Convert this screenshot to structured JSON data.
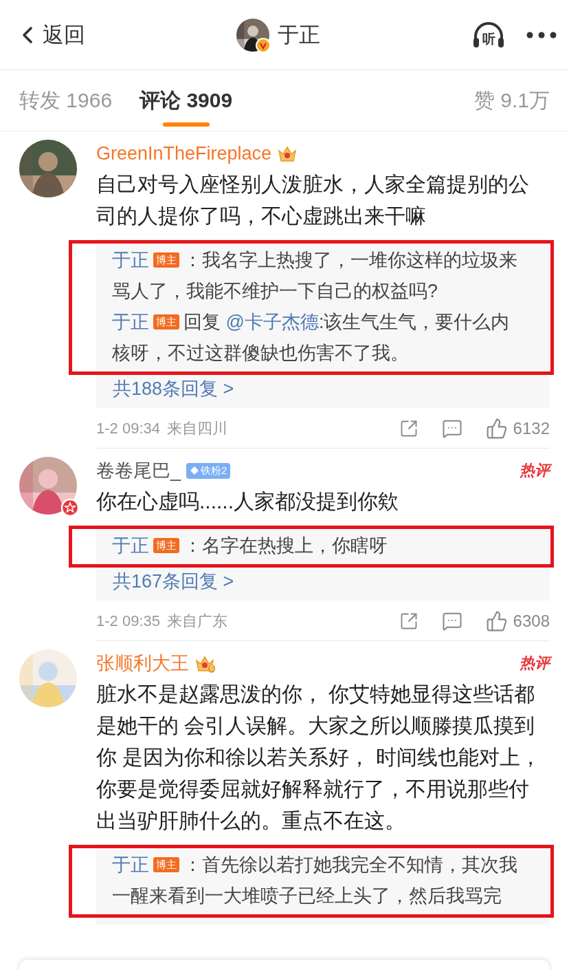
{
  "header": {
    "back_label": "返回",
    "title": "于正",
    "verified": true,
    "listen_label": "听"
  },
  "tabs": [
    {
      "label": "转发 1966",
      "selected": false
    },
    {
      "label": "评论 3909",
      "selected": true
    }
  ],
  "likes_tab": "赞 9.1万",
  "comments": [
    {
      "name": "GreenInTheFireplace",
      "vip": true,
      "verified": false,
      "badge": {
        "kind": "crown"
      },
      "text": "自己对号入座怪别人泼脏水，人家全篇提别的公司的人提你了吗，不心虚跳出来干嘛",
      "replies": [
        {
          "author": "于正",
          "tag": "博主",
          "text": "：我名字上热搜了，一堆你这样的垃圾来骂人了，我能不维护一下自己的权益吗?"
        },
        {
          "author": "于正",
          "tag": "博主",
          "prefix": "回复",
          "mention": "@卡子杰德",
          "text": ":该生气生气，要什么内核呀，不过这群傻缺也伤害不了我。"
        }
      ],
      "highlighted": true,
      "more": "共188条回复 >",
      "time": "1-2 09:34",
      "location": "来自四川",
      "likes": "6132"
    },
    {
      "name": "卷卷尾巴_",
      "vip": false,
      "verified": true,
      "badge": {
        "kind": "fan",
        "text": "铁粉2"
      },
      "hot": "热评",
      "text": "你在心虚吗......人家都没提到你欸",
      "replies": [
        {
          "author": "于正",
          "tag": "博主",
          "text": "：名字在热搜上，你瞎呀"
        }
      ],
      "highlighted": true,
      "more": "共167条回复 >",
      "time": "1-2 09:35",
      "location": "来自广东",
      "likes": "6308"
    },
    {
      "name": "张顺利大王",
      "vip": true,
      "verified": false,
      "badge": {
        "kind": "crown",
        "text": "6"
      },
      "hot": "热评",
      "text": "脏水不是赵露思泼的你， 你艾特她显得这些话都是她干的 会引人误解。大家之所以顺滕摸瓜摸到你 是因为你和徐以若关系好， 时间线也能对上，你要是觉得委屈就好解释就行了，不用说那些付出当驴肝肺什么的。重点不在这。",
      "replies": [
        {
          "author": "于正",
          "tag": "博主",
          "text": "：首先徐以若打她我完全不知情，其次我一醒来看到一大堆喷子已经上头了，然后我骂完"
        }
      ],
      "highlighted": true
    }
  ]
}
